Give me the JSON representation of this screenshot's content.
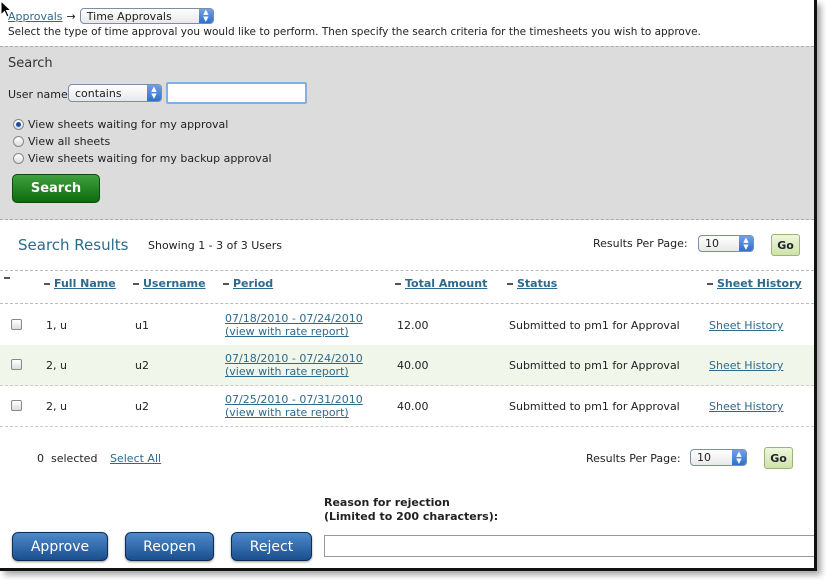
{
  "breadcrumb": {
    "link": "Approvals",
    "arrow": "→",
    "selected": "Time Approvals"
  },
  "intro": "Select the type of time approval you would like to perform. Then specify the search criteria for the timesheets you wish to approve.",
  "search": {
    "title": "Search",
    "username_label": "User name",
    "operator": "contains",
    "value": "",
    "radios": [
      {
        "label": "View sheets waiting for my approval",
        "checked": true
      },
      {
        "label": "View all sheets",
        "checked": false
      },
      {
        "label": "View sheets waiting for my backup approval",
        "checked": false
      }
    ],
    "button": "Search"
  },
  "results": {
    "title": "Search Results",
    "showing": "Showing 1 - 3 of 3 Users",
    "per_page_label": "Results Per Page:",
    "per_page": "10",
    "go": "Go",
    "columns": {
      "full_name": "Full Name",
      "username": "Username",
      "period": "Period",
      "total_amount": "Total Amount",
      "status": "Status",
      "sheet_history": "Sheet History"
    },
    "rows": [
      {
        "full_name": "1, u",
        "username": "u1",
        "period": "07/18/2010 - 07/24/2010",
        "rate_link": "(view with rate report)",
        "total": "12.00",
        "status": "Submitted to pm1 for Approval",
        "history": "Sheet History"
      },
      {
        "full_name": "2, u",
        "username": "u2",
        "period": "07/18/2010 - 07/24/2010",
        "rate_link": "(view with rate report)",
        "total": "40.00",
        "status": "Submitted to pm1 for Approval",
        "history": "Sheet History"
      },
      {
        "full_name": "2, u",
        "username": "u2",
        "period": "07/25/2010 - 07/31/2010",
        "rate_link": "(view with rate report)",
        "total": "40.00",
        "status": "Submitted to pm1 for Approval",
        "history": "Sheet History"
      }
    ],
    "selected_count": "0",
    "selected_label": "selected",
    "select_all": "Select All"
  },
  "actions": {
    "approve": "Approve",
    "reopen": "Reopen",
    "reject": "Reject",
    "reason_line1": "Reason for rejection",
    "reason_line2": "(Limited to 200 characters):"
  }
}
